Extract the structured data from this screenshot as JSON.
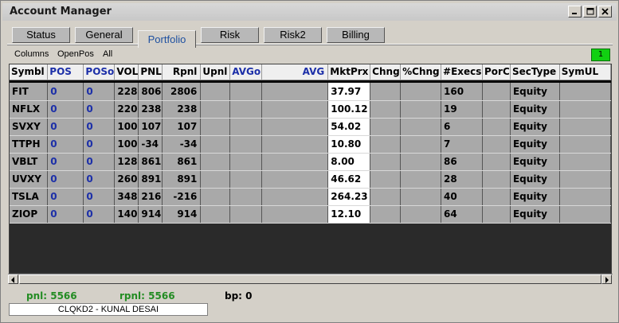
{
  "window": {
    "title": "Account Manager"
  },
  "tabs": [
    "Status",
    "General",
    "Portfolio",
    "Risk",
    "Risk2",
    "Billing"
  ],
  "active_tab": "Portfolio",
  "toolbar": {
    "columns": "Columns",
    "openpos": "OpenPos",
    "all": "All",
    "indicator": "1"
  },
  "columns": [
    "Symbl",
    "POS",
    "POSo",
    "VOL",
    "PNL",
    "Rpnl",
    "Upnl",
    "AVGo",
    "AVG",
    "MktPrx",
    "Chng",
    "%Chng",
    "#Execs",
    "PorC",
    "SecType",
    "SymUL"
  ],
  "rows": [
    [
      "FIT",
      "0",
      "0",
      "228",
      "806",
      "2806",
      "",
      "",
      "",
      "37.97",
      "",
      "",
      "160",
      "",
      "Equity",
      ""
    ],
    [
      "NFLX",
      "0",
      "0",
      "220",
      "238",
      "238",
      "",
      "",
      "",
      "100.12",
      "",
      "",
      "19",
      "",
      "Equity",
      ""
    ],
    [
      "SVXY",
      "0",
      "0",
      "100",
      "107",
      "107",
      "",
      "",
      "",
      "54.02",
      "",
      "",
      "6",
      "",
      "Equity",
      ""
    ],
    [
      "TTPH",
      "0",
      "0",
      "100",
      "-34",
      "-34",
      "",
      "",
      "",
      "10.80",
      "",
      "",
      "7",
      "",
      "Equity",
      ""
    ],
    [
      "VBLT",
      "0",
      "0",
      "128",
      "861",
      "861",
      "",
      "",
      "",
      "8.00",
      "",
      "",
      "86",
      "",
      "Equity",
      ""
    ],
    [
      "UVXY",
      "0",
      "0",
      "260",
      "891",
      "891",
      "",
      "",
      "",
      "46.62",
      "",
      "",
      "28",
      "",
      "Equity",
      ""
    ],
    [
      "TSLA",
      "0",
      "0",
      "348",
      "216",
      "-216",
      "",
      "",
      "",
      "264.23",
      "",
      "",
      "40",
      "",
      "Equity",
      ""
    ],
    [
      "ZIOP",
      "0",
      "0",
      "140",
      "914",
      "914",
      "",
      "",
      "",
      "12.10",
      "",
      "",
      "64",
      "",
      "Equity",
      ""
    ]
  ],
  "status": {
    "pnl": "pnl: 5566",
    "rpnl": "rpnl: 5566",
    "bp": "bp: 0",
    "user": "CLQKD2 - KUNAL DESAI"
  },
  "colors": {
    "pnl_green": "#238c23",
    "blue_header": "#1c2fa8",
    "indicator_green": "#11d011"
  }
}
